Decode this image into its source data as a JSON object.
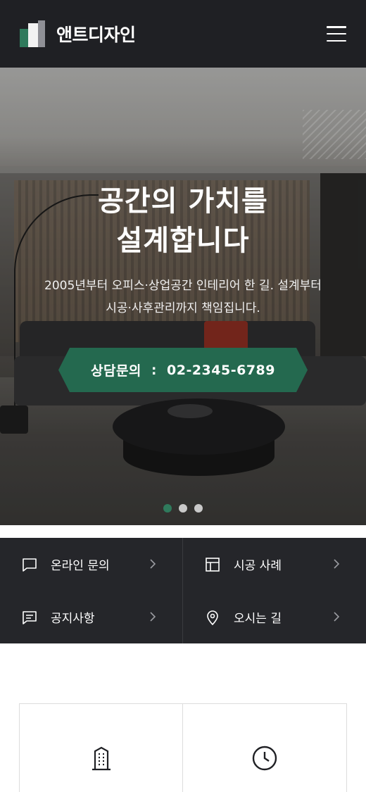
{
  "brand": {
    "name": "앤트디자인"
  },
  "hero": {
    "title_line1": "공간의 가치를",
    "title_line2": "설계합니다",
    "desc_line1": "2005년부터 오피스·상업공간 인테리어 한 길. 설계부터",
    "desc_line2": "시공·사후관리까지 책임집니다.",
    "cta_label": "상담문의",
    "cta_sep": ":",
    "cta_phone": "02-2345-6789",
    "slides_total": 3,
    "slide_active": 1
  },
  "quick_menu": [
    {
      "label": "온라인 문의",
      "icon": "chat-icon"
    },
    {
      "label": "시공 사례",
      "icon": "layout-icon"
    },
    {
      "label": "공지사항",
      "icon": "notice-icon"
    },
    {
      "label": "오시는 길",
      "icon": "location-pin-icon"
    }
  ],
  "info_cards": [
    {
      "icon": "building-icon",
      "label": ""
    },
    {
      "icon": "clock-icon",
      "label": ""
    }
  ],
  "colors": {
    "header_bg": "#1f2024",
    "accent_green": "#24694f",
    "quick_bg": "#25262a"
  }
}
